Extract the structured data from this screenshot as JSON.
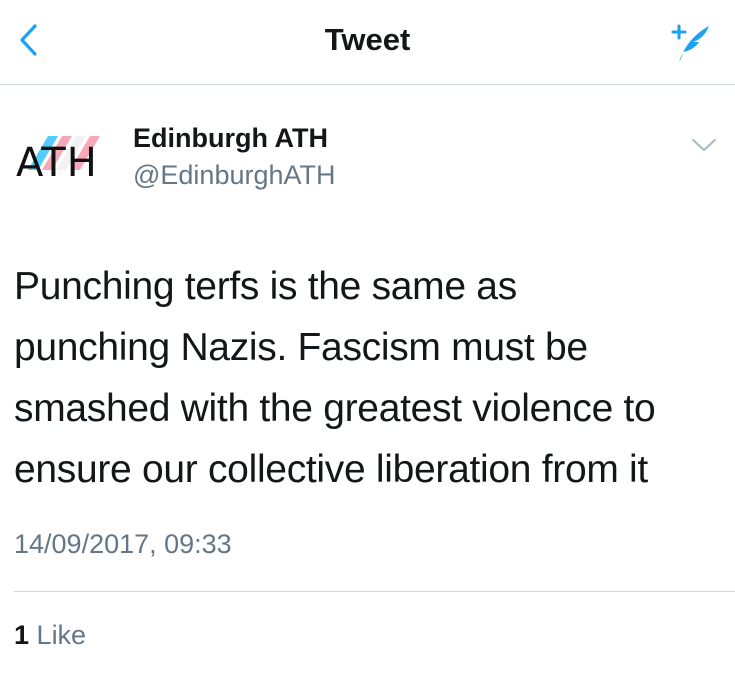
{
  "header": {
    "title": "Tweet",
    "back_icon": "chevron-left-icon",
    "compose_icon": "compose-tweet-icon",
    "accent_color": "#1da1f2"
  },
  "author": {
    "avatar_text": "ATH",
    "avatar_colors": [
      "#55cdfc",
      "#f7a8b8"
    ],
    "display_name": "Edinburgh ATH",
    "handle": "@EdinburghATH",
    "menu_icon": "chevron-down-icon"
  },
  "tweet": {
    "lines": [
      "Punching terfs is the same as",
      "punching Nazis. Fascism must be",
      "smashed with the greatest violence to",
      "ensure our collective liberation from it"
    ],
    "timestamp": "14/09/2017, 09:33"
  },
  "stats": {
    "like_count": "1",
    "like_label": "Like"
  }
}
